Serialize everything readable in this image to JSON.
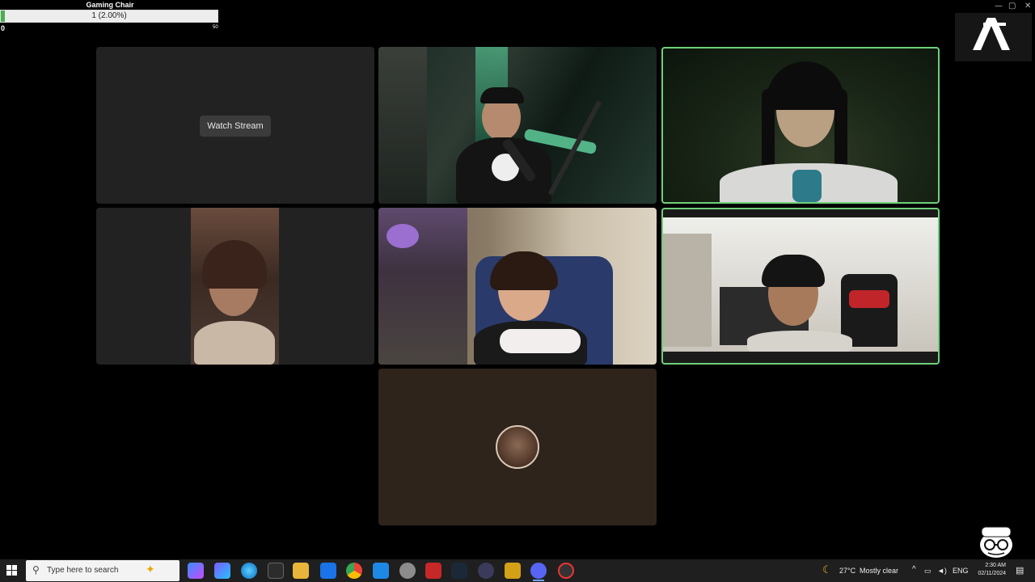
{
  "goal": {
    "title": "Gaming Chair",
    "progress_text": "1 (2.00%)",
    "progress_fraction": 0.02,
    "min_label": "0",
    "max_label": "50"
  },
  "tiles": {
    "watch_stream_label": "Watch Stream"
  },
  "taskbar": {
    "search_placeholder": "Type here to search",
    "weather_temp": "27°C",
    "weather_text": "Mostly clear",
    "language": "ENG",
    "time": "2:30 AM",
    "date": "02/11/2024"
  },
  "colors": {
    "speaking_border": "#6fd07a",
    "tile_bg": "#222222",
    "taskbar_bg": "#1f1f1f",
    "goal_fill": "#4caf50"
  }
}
